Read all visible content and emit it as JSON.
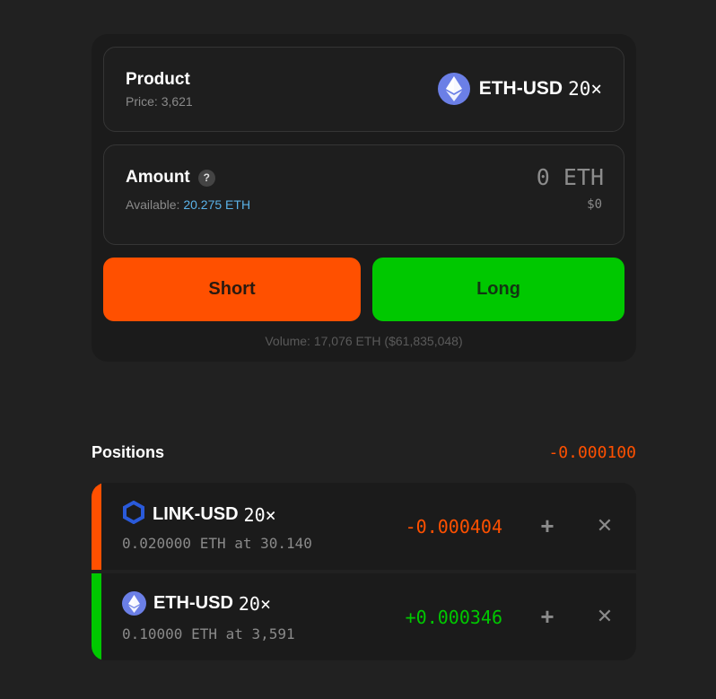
{
  "product": {
    "title": "Product",
    "price_label": "Price:",
    "price": "3,621",
    "pair": "ETH-USD",
    "leverage": "20×",
    "icon": "ethereum-icon"
  },
  "amount": {
    "title": "Amount",
    "help": "?",
    "available_label": "Available:",
    "available_value": "20.275 ETH",
    "input_value": "0 ETH",
    "usd_value": "$0"
  },
  "buttons": {
    "short_label": "Short",
    "long_label": "Long"
  },
  "volume_text": "Volume: 17,076 ETH ($61,835,048)",
  "positions": {
    "title": "Positions",
    "total": "-0.000100",
    "items": [
      {
        "pair": "LINK-USD",
        "leverage": "20×",
        "icon": "chainlink-icon",
        "detail": "0.020000 ETH at 30.140",
        "pnl": "-0.000404",
        "side": "short",
        "add_icon": "plus-icon",
        "close_icon": "close-icon"
      },
      {
        "pair": "ETH-USD",
        "leverage": "20×",
        "icon": "ethereum-icon",
        "detail": "0.10000 ETH at 3,591",
        "pnl": "+0.000346",
        "side": "long",
        "add_icon": "plus-icon",
        "close_icon": "close-icon"
      }
    ]
  },
  "colors": {
    "background": "#212121",
    "panel": "#1b1b1b",
    "short": "#ff5000",
    "long": "#00c800",
    "accent_blue": "#5ab2e8",
    "eth": "#6b7fe6",
    "link": "#2a5ada"
  }
}
